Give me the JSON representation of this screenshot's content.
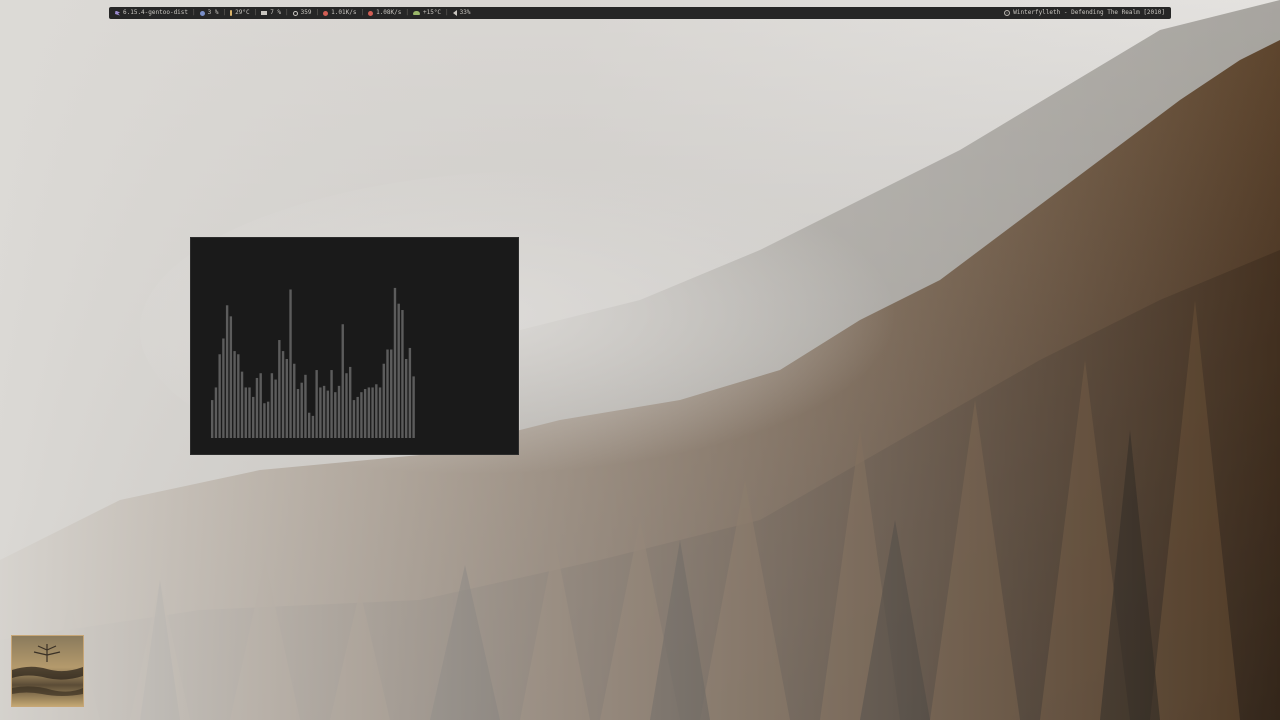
{
  "statusbar": {
    "kernel": "6.15.4-gentoo-dist",
    "cpu": "3 %",
    "temperature": "29°C",
    "memory": "7 %",
    "packages": "359",
    "net_down": "1.01K/s",
    "net_up": "1.08K/s",
    "weather": "+15°C",
    "volume": "33%",
    "now_playing": "Winterfylleth - Defending The Realm [2010]",
    "separator": "|"
  },
  "icons": {
    "kernel": "gentoo-icon",
    "cpu": "cpu-icon",
    "temperature": "thermometer-icon",
    "memory": "memory-icon",
    "packages": "package-icon",
    "net_down": "download-icon",
    "net_up": "upload-icon",
    "weather": "cloud-icon",
    "volume": "speaker-icon",
    "now_playing": "music-disc-icon"
  },
  "visualizer": {
    "bar_levels": [
      0.24,
      0.32,
      0.53,
      0.63,
      0.84,
      0.77,
      0.55,
      0.53,
      0.42,
      0.32,
      0.32,
      0.26,
      0.38,
      0.41,
      0.22,
      0.23,
      0.41,
      0.37,
      0.62,
      0.55,
      0.5,
      0.94,
      0.47,
      0.31,
      0.35,
      0.4,
      0.16,
      0.14,
      0.43,
      0.32,
      0.33,
      0.3,
      0.43,
      0.29,
      0.33,
      0.72,
      0.41,
      0.45,
      0.24,
      0.26,
      0.29,
      0.31,
      0.32,
      0.32,
      0.34,
      0.32,
      0.47,
      0.56,
      0.56,
      0.95,
      0.85,
      0.81,
      0.5,
      0.57,
      0.39
    ],
    "bar_color": "#5c5c5c"
  },
  "colors": {
    "bar_background": "#262626",
    "bar_text": "#c9c6c0",
    "window_background": "#1a1a1a"
  }
}
